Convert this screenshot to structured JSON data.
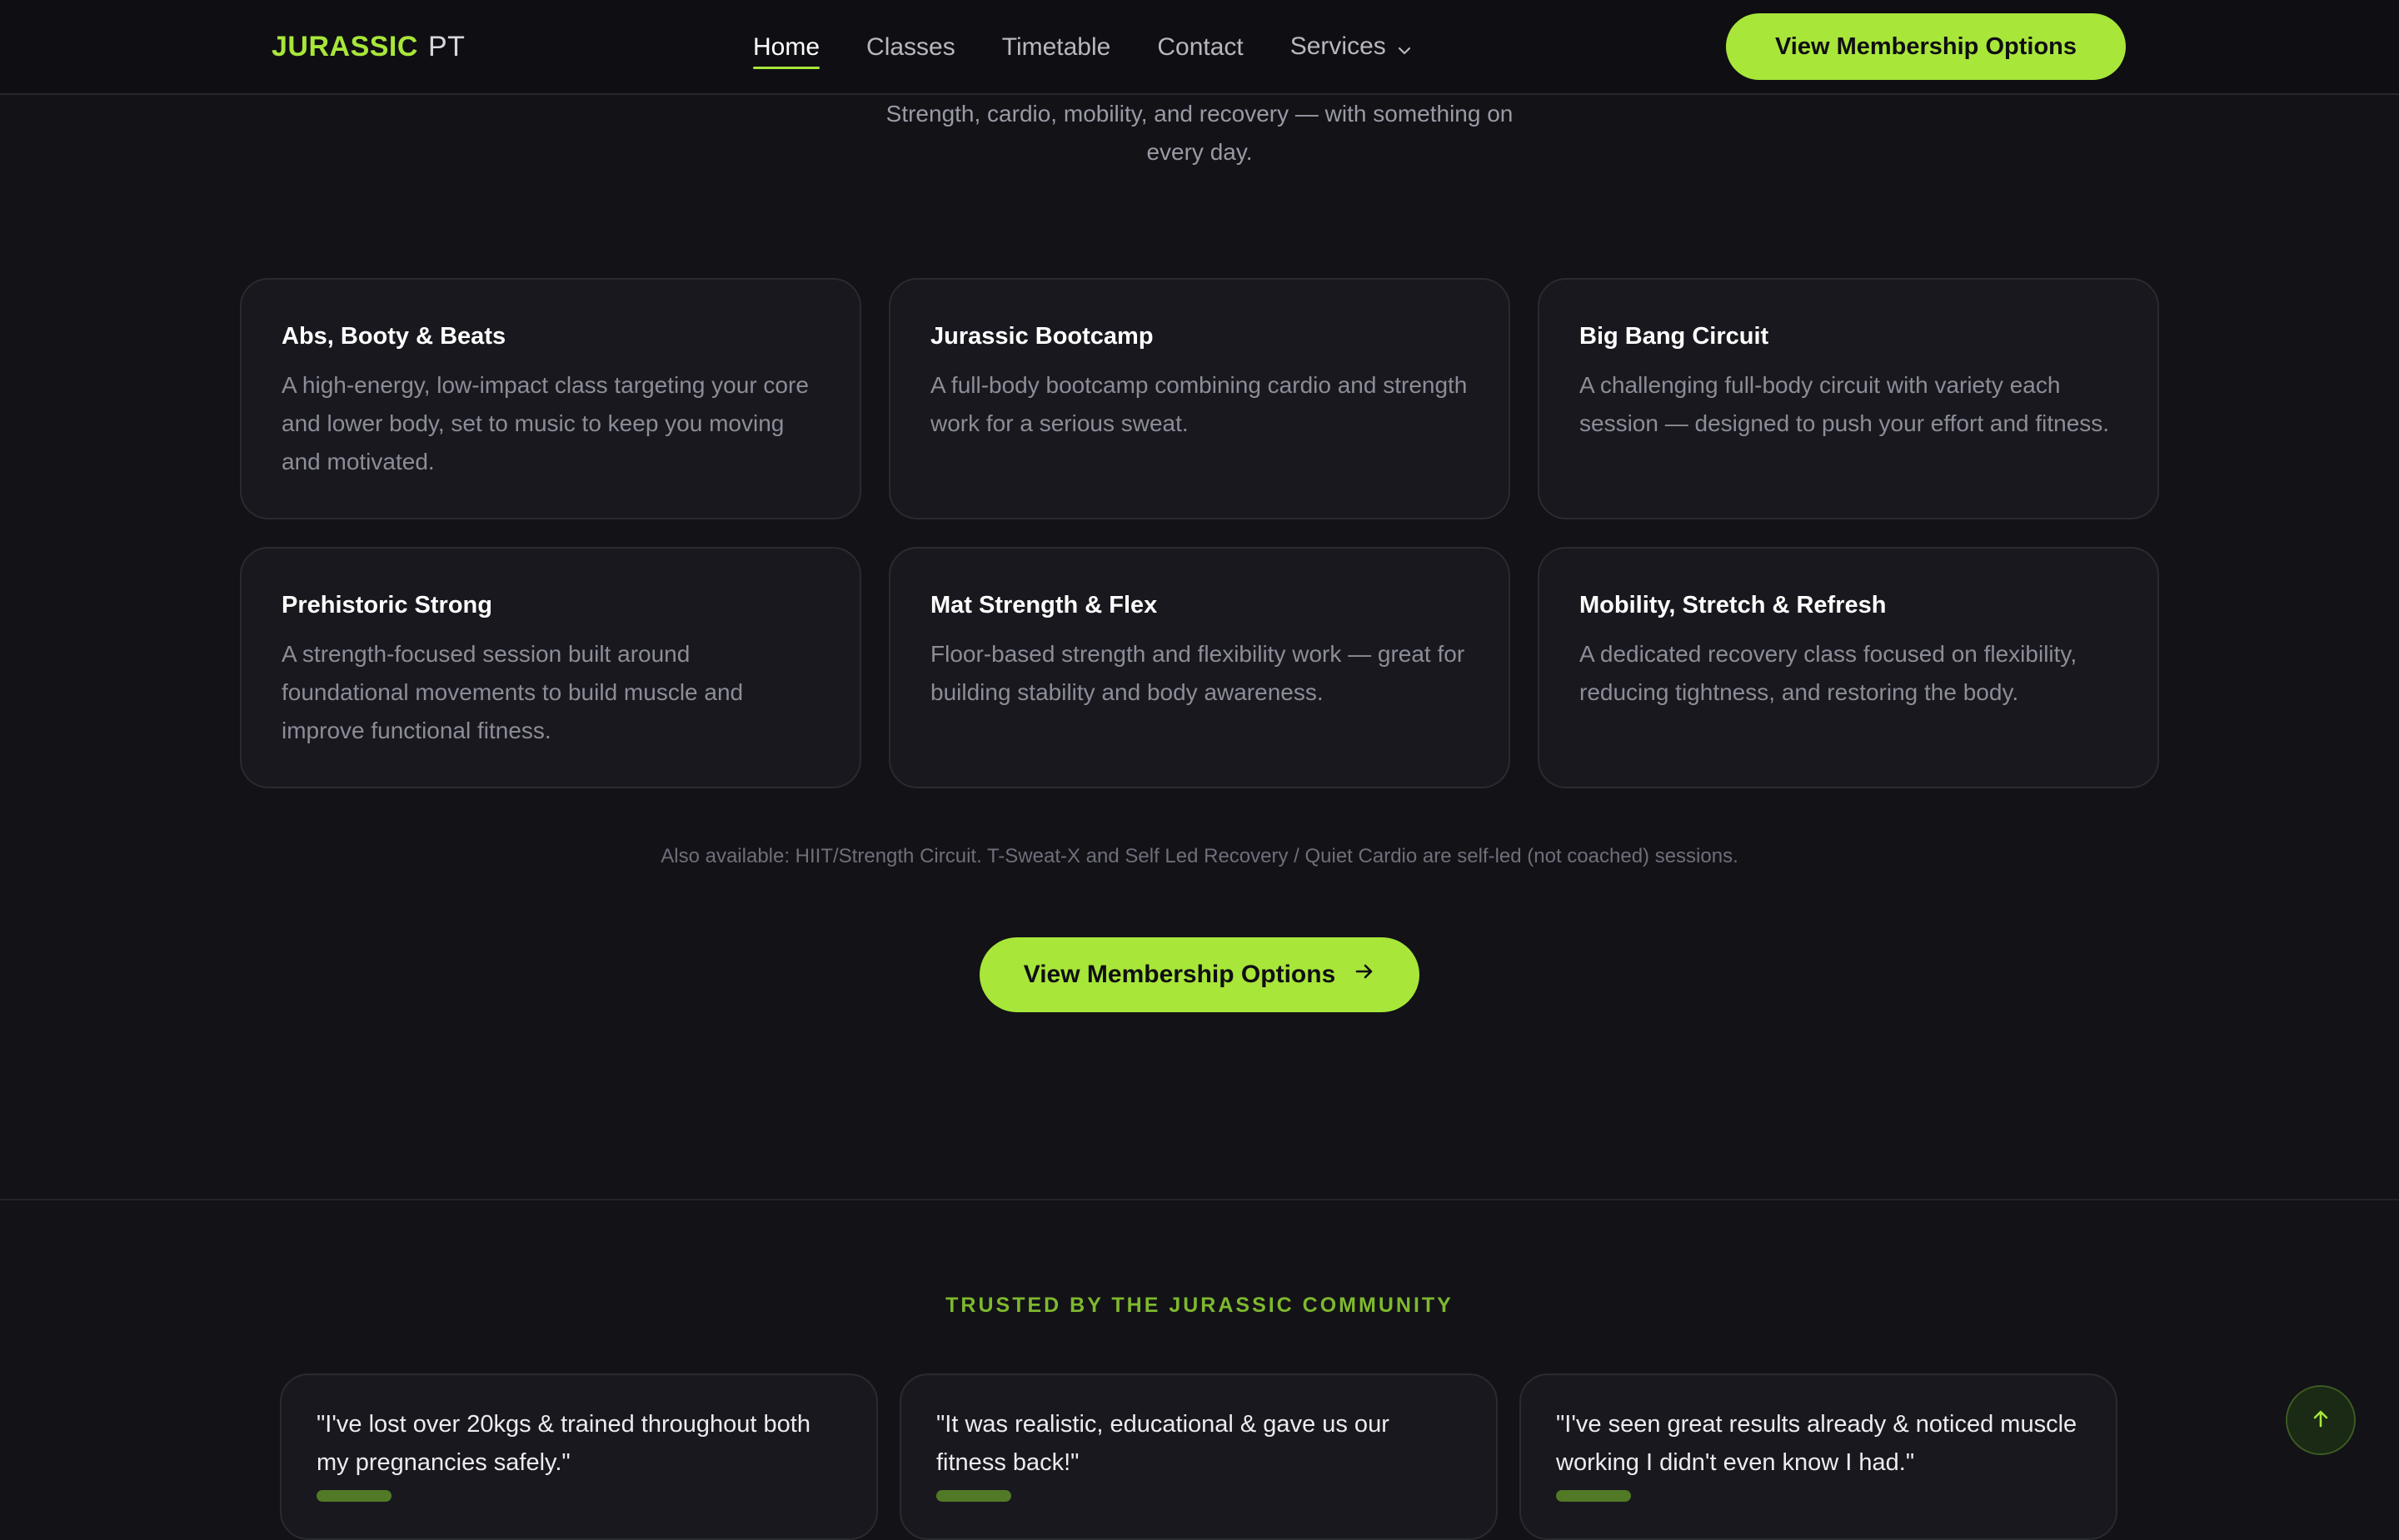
{
  "nav": {
    "logo_brand": "JURASSIC",
    "logo_suffix": "PT",
    "links": [
      "Home",
      "Classes",
      "Timetable",
      "Contact",
      "Services"
    ],
    "active": "Home",
    "cta_label": "View Membership Options"
  },
  "hero": {
    "subtitle": "Strength, cardio, mobility, and recovery — with something on every day."
  },
  "classes": [
    {
      "title": "Abs, Booty & Beats",
      "desc": "A high-energy, low-impact class targeting your core and lower body, set to music to keep you moving and motivated."
    },
    {
      "title": "Jurassic Bootcamp",
      "desc": "A full-body bootcamp combining cardio and strength work for a serious sweat."
    },
    {
      "title": "Big Bang Circuit",
      "desc": "A challenging full-body circuit with variety each session — designed to push your effort and fitness."
    },
    {
      "title": "Prehistoric Strong",
      "desc": "A strength-focused session built around foundational movements to build muscle and improve functional fitness."
    },
    {
      "title": "Mat Strength & Flex",
      "desc": "Floor-based strength and flexibility work — great for building stability and body awareness."
    },
    {
      "title": "Mobility, Stretch & Refresh",
      "desc": "A dedicated recovery class focused on flexibility, reducing tightness, and restoring the body."
    }
  ],
  "also_available": "Also available: HIIT/Strength Circuit. T-Sweat-X and Self Led Recovery / Quiet Cardio are self-led (not coached) sessions.",
  "main_cta": {
    "label": "View Membership Options",
    "icon": "arrow-right-icon"
  },
  "community": {
    "heading": "TRUSTED BY THE JURASSIC COMMUNITY",
    "testimonials": [
      {
        "quote": "\"I've lost over 20kgs & trained throughout both my pregnancies safely.\""
      },
      {
        "quote": "\"It was realistic, educational & gave us our fitness back!\""
      },
      {
        "quote": "\"I've seen great results already & noticed muscle working I didn't even know I had.\""
      }
    ]
  },
  "colors": {
    "accent": "#a8e63a",
    "background": "#121217",
    "card": "#18181e"
  },
  "icons": {
    "services_dropdown": "chevron-down-icon",
    "scroll_top": "arrow-up-icon"
  }
}
